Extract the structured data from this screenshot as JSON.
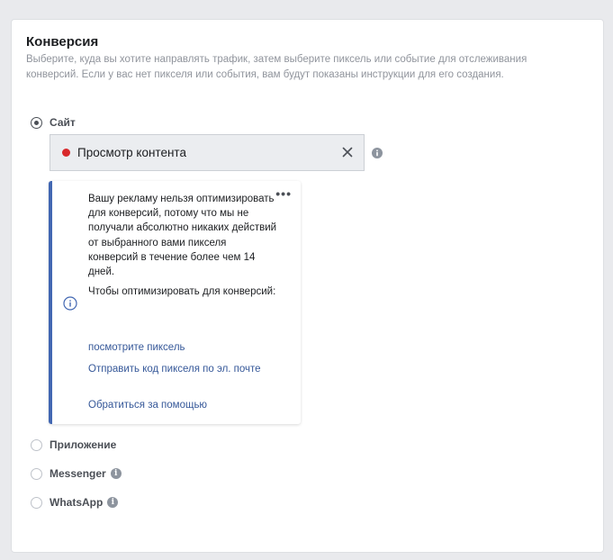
{
  "section": {
    "title": "Конверсия",
    "description": "Выберите, куда вы хотите направлять трафик, затем выберите пиксель или событие для отслеживания конверсий. Если у вас нет пикселя или события, вам будут показаны инструкции для его создания."
  },
  "options": {
    "site": {
      "label": "Сайт",
      "selected": true
    },
    "app": {
      "label": "Приложение",
      "selected": false
    },
    "messenger": {
      "label": "Messenger",
      "selected": false
    },
    "whatsapp": {
      "label": "WhatsApp",
      "selected": false
    }
  },
  "event_select": {
    "value": "Просмотр контента",
    "status_color": "#d8282b"
  },
  "notice": {
    "message": "Вашу рекламу нельзя оптимизировать для конверсий, потому что мы не получали абсолютно никаких действий от выбранного вами пикселя конверсий в течение более чем 14 дней.",
    "prompt": "Чтобы оптимизировать для конверсий:",
    "links": {
      "view_pixel": "посмотрите пиксель",
      "email_code": "Отправить код пикселя по эл. почте",
      "get_help": "Обратиться за помощью"
    },
    "accent_color": "#4267b2"
  },
  "icons": {
    "info": "info-icon",
    "clear": "close-icon",
    "more": "more-icon"
  }
}
